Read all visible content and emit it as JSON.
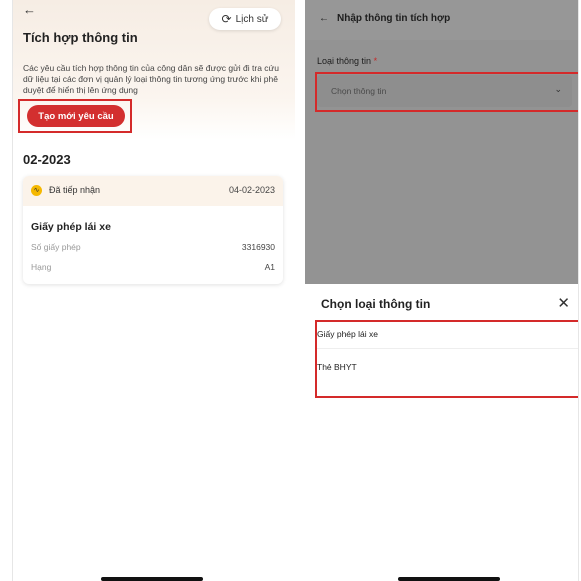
{
  "left": {
    "back_icon": "arrow-left-icon",
    "history_label": "Lịch sử",
    "history_icon": "history-icon",
    "title": "Tích hợp thông tin",
    "description": "Các yêu cầu tích hợp thông tin của công dân sẽ được gửi đi tra cứu dữ liệu tại các đơn vị quản lý loại thông tin tương ứng trước khi phê duyệt để hiển thị lên ứng dụng",
    "create_button": "Tạo mới yêu cầu",
    "month": "02-2023",
    "card": {
      "status": "Đã tiếp nhận",
      "status_icon": "status-received-icon",
      "date": "04-02-2023",
      "doc_title": "Giấy phép lái xe",
      "rows": [
        {
          "label": "Số giấy phép",
          "value": "3316930"
        },
        {
          "label": "Hạng",
          "value": "A1"
        }
      ]
    }
  },
  "right": {
    "back_icon": "arrow-left-icon",
    "header_title": "Nhập thông tin tích hợp",
    "field_label": "Loại thông tin",
    "required_mark": "*",
    "select_placeholder": "Chọn thông tin",
    "chevron_icon": "chevron-down-icon",
    "sheet": {
      "title": "Chọn loại thông tin",
      "close_icon": "close-icon",
      "options": [
        "Giấy phép lái xe",
        "Thẻ BHYT"
      ]
    }
  },
  "colors": {
    "accent": "#d32f2f",
    "highlight": "#d42a2a",
    "status_yellow": "#f5b800"
  }
}
